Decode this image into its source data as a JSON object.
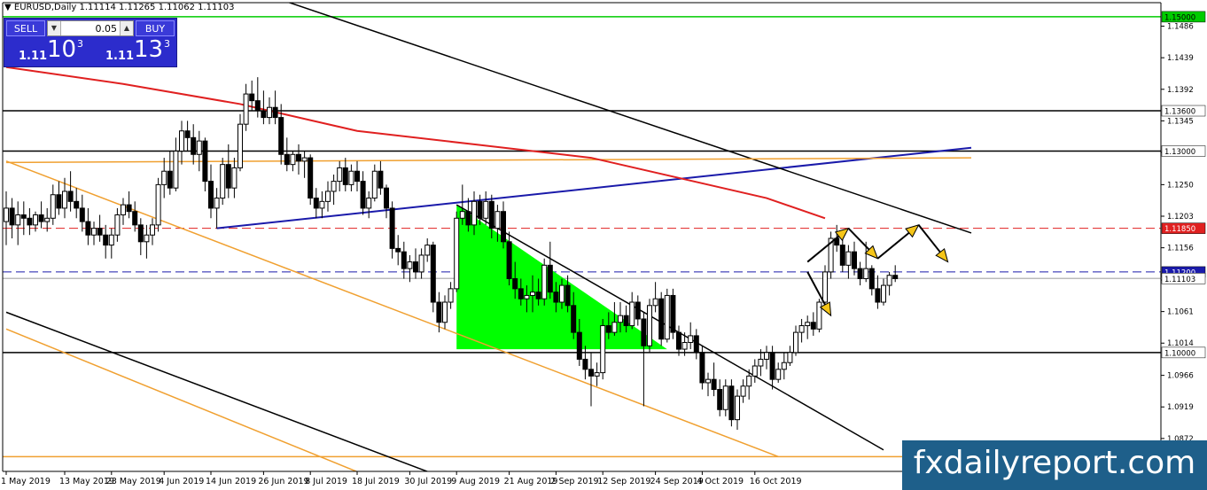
{
  "header": {
    "icon": "triangle-down-icon",
    "symbol": "EURUSD,Daily",
    "ohlc": "1.11114 1.11265 1.11062 1.11103"
  },
  "trade_panel": {
    "sell_label": "SELL",
    "buy_label": "BUY",
    "lot_value": "0.05",
    "sell_price_prefix": "1.11",
    "sell_price_big": "10",
    "sell_price_sup": "3",
    "buy_price_prefix": "1.11",
    "buy_price_big": "13",
    "buy_price_sup": "3"
  },
  "watermark": "fxdailyreport.com",
  "colors": {
    "bull": "#ffffff",
    "bear": "#000000",
    "ma": "#e02020",
    "trend_blue": "#1a1aaa",
    "channel_orange": "#f0a030",
    "level_green": "#00cc00",
    "triangle_fill": "#00ff00",
    "arrow_fill": "#f5c518"
  },
  "chart_data": {
    "type": "candlestick",
    "symbol": "EURUSD",
    "timeframe": "Daily",
    "ylim": [
      1.0823,
      1.1521
    ],
    "y_ticks": [
      1.1486,
      1.1439,
      1.1392,
      1.1345,
      1.1298,
      1.125,
      1.1203,
      1.1156,
      1.1108,
      1.1061,
      1.1014,
      1.0966,
      1.0919,
      1.0872
    ],
    "x_ticks": [
      "1 May 2019",
      "13 May 2019",
      "23 May 2019",
      "4 Jun 2019",
      "14 Jun 2019",
      "26 Jun 2019",
      "8 Jul 2019",
      "18 Jul 2019",
      "30 Jul 2019",
      "9 Aug 2019",
      "21 Aug 2019",
      "2 Sep 2019",
      "12 Sep 2019",
      "24 Sep 2019",
      "4 Oct 2019",
      "16 Oct 2019"
    ],
    "x_tick_bars": [
      0,
      10,
      18,
      27,
      35,
      44,
      52,
      60,
      69,
      77,
      86,
      94,
      102,
      111,
      119,
      128
    ],
    "hlines": [
      {
        "price": 1.15,
        "label": "1.15000",
        "color": "#00cc00",
        "style": "solid",
        "label_bg": "#00cc00",
        "label_fg": "#000000"
      },
      {
        "price": 1.136,
        "label": "1.13600",
        "color": "#000000",
        "style": "solid",
        "label_bg": "#ffffff",
        "label_fg": "#000000"
      },
      {
        "price": 1.13,
        "label": "1.13000",
        "color": "#000000",
        "style": "solid",
        "label_bg": "#ffffff",
        "label_fg": "#000000"
      },
      {
        "price": 1.1185,
        "label": "1.11850",
        "color": "#e02020",
        "style": "dashed",
        "label_bg": "#e02020",
        "label_fg": "#ffffff"
      },
      {
        "price": 1.112,
        "label": "1.11200",
        "color": "#1a1aaa",
        "style": "dashed",
        "label_bg": "#1a1aaa",
        "label_fg": "#ffffff"
      },
      {
        "price": 1.11103,
        "label": "1.11103",
        "color": "#bbbbbb",
        "style": "solid",
        "label_bg": "#ffffff",
        "label_fg": "#000000"
      },
      {
        "price": 1.1,
        "label": "1.10000",
        "color": "#000000",
        "style": "solid",
        "label_bg": "#ffffff",
        "label_fg": "#000000"
      },
      {
        "price": 1.0845,
        "label": "",
        "color": "#f0a030",
        "style": "solid",
        "label_bg": "#ffffff",
        "label_fg": "#000000"
      }
    ],
    "candles": [
      [
        1.1195,
        1.124,
        1.116,
        1.1215
      ],
      [
        1.1215,
        1.123,
        1.117,
        1.119
      ],
      [
        1.119,
        1.1225,
        1.116,
        1.1205
      ],
      [
        1.1205,
        1.1225,
        1.1175,
        1.12
      ],
      [
        1.12,
        1.1215,
        1.1175,
        1.119
      ],
      [
        1.119,
        1.121,
        1.118,
        1.1205
      ],
      [
        1.1205,
        1.1225,
        1.1185,
        1.1195
      ],
      [
        1.1195,
        1.1215,
        1.118,
        1.12
      ],
      [
        1.12,
        1.125,
        1.119,
        1.1235
      ],
      [
        1.1235,
        1.1255,
        1.1205,
        1.1215
      ],
      [
        1.1215,
        1.126,
        1.12,
        1.124
      ],
      [
        1.124,
        1.127,
        1.121,
        1.1225
      ],
      [
        1.1225,
        1.1245,
        1.12,
        1.1215
      ],
      [
        1.1215,
        1.1235,
        1.118,
        1.1195
      ],
      [
        1.1195,
        1.1215,
        1.116,
        1.1175
      ],
      [
        1.1175,
        1.1195,
        1.116,
        1.1185
      ],
      [
        1.1185,
        1.1205,
        1.1165,
        1.1175
      ],
      [
        1.1175,
        1.119,
        1.114,
        1.116
      ],
      [
        1.116,
        1.1185,
        1.114,
        1.1175
      ],
      [
        1.1175,
        1.1215,
        1.1165,
        1.1205
      ],
      [
        1.1205,
        1.123,
        1.119,
        1.122
      ],
      [
        1.122,
        1.124,
        1.12,
        1.121
      ],
      [
        1.121,
        1.1225,
        1.118,
        1.119
      ],
      [
        1.119,
        1.12,
        1.1145,
        1.1165
      ],
      [
        1.1165,
        1.119,
        1.114,
        1.1175
      ],
      [
        1.1175,
        1.12,
        1.116,
        1.119
      ],
      [
        1.119,
        1.126,
        1.118,
        1.125
      ],
      [
        1.125,
        1.129,
        1.123,
        1.127
      ],
      [
        1.127,
        1.13,
        1.1235,
        1.1245
      ],
      [
        1.1245,
        1.132,
        1.124,
        1.13
      ],
      [
        1.13,
        1.1345,
        1.128,
        1.133
      ],
      [
        1.133,
        1.1345,
        1.13,
        1.132
      ],
      [
        1.132,
        1.134,
        1.128,
        1.1295
      ],
      [
        1.1295,
        1.133,
        1.127,
        1.1315
      ],
      [
        1.1315,
        1.132,
        1.124,
        1.1255
      ],
      [
        1.1255,
        1.128,
        1.12,
        1.1215
      ],
      [
        1.1215,
        1.1245,
        1.1185,
        1.123
      ],
      [
        1.123,
        1.129,
        1.122,
        1.128
      ],
      [
        1.128,
        1.131,
        1.123,
        1.1245
      ],
      [
        1.1245,
        1.129,
        1.123,
        1.1275
      ],
      [
        1.1275,
        1.1355,
        1.127,
        1.134
      ],
      [
        1.134,
        1.14,
        1.133,
        1.1385
      ],
      [
        1.1385,
        1.1405,
        1.136,
        1.1375
      ],
      [
        1.1375,
        1.141,
        1.135,
        1.136
      ],
      [
        1.136,
        1.139,
        1.134,
        1.135
      ],
      [
        1.135,
        1.138,
        1.134,
        1.1365
      ],
      [
        1.1365,
        1.139,
        1.134,
        1.135
      ],
      [
        1.135,
        1.137,
        1.128,
        1.1295
      ],
      [
        1.1295,
        1.132,
        1.127,
        1.128
      ],
      [
        1.128,
        1.13,
        1.127,
        1.1295
      ],
      [
        1.1295,
        1.131,
        1.1265,
        1.1285
      ],
      [
        1.1285,
        1.13,
        1.126,
        1.129
      ],
      [
        1.129,
        1.1295,
        1.122,
        1.123
      ],
      [
        1.123,
        1.1245,
        1.12,
        1.1215
      ],
      [
        1.1215,
        1.124,
        1.12,
        1.1225
      ],
      [
        1.1225,
        1.1255,
        1.121,
        1.124
      ],
      [
        1.124,
        1.1265,
        1.122,
        1.1255
      ],
      [
        1.1255,
        1.1285,
        1.124,
        1.1275
      ],
      [
        1.1275,
        1.129,
        1.124,
        1.125
      ],
      [
        1.125,
        1.128,
        1.124,
        1.127
      ],
      [
        1.127,
        1.1285,
        1.124,
        1.1255
      ],
      [
        1.1255,
        1.127,
        1.1205,
        1.1215
      ],
      [
        1.1215,
        1.124,
        1.12,
        1.123
      ],
      [
        1.123,
        1.128,
        1.1225,
        1.127
      ],
      [
        1.127,
        1.1285,
        1.1235,
        1.1245
      ],
      [
        1.1245,
        1.125,
        1.12,
        1.1215
      ],
      [
        1.1215,
        1.1225,
        1.114,
        1.1155
      ],
      [
        1.1155,
        1.1175,
        1.113,
        1.115
      ],
      [
        1.115,
        1.1165,
        1.111,
        1.1125
      ],
      [
        1.1125,
        1.1145,
        1.1105,
        1.1135
      ],
      [
        1.1135,
        1.1155,
        1.111,
        1.112
      ],
      [
        1.112,
        1.1155,
        1.111,
        1.1145
      ],
      [
        1.1145,
        1.117,
        1.1135,
        1.116
      ],
      [
        1.116,
        1.1165,
        1.106,
        1.1075
      ],
      [
        1.1075,
        1.109,
        1.103,
        1.1045
      ],
      [
        1.1045,
        1.1085,
        1.1035,
        1.1075
      ],
      [
        1.1075,
        1.1105,
        1.1065,
        1.1095
      ],
      [
        1.1095,
        1.121,
        1.109,
        1.12
      ],
      [
        1.12,
        1.125,
        1.119,
        1.121
      ],
      [
        1.121,
        1.123,
        1.118,
        1.119
      ],
      [
        1.119,
        1.124,
        1.1175,
        1.1225
      ],
      [
        1.1225,
        1.1235,
        1.119,
        1.12
      ],
      [
        1.12,
        1.124,
        1.119,
        1.1225
      ],
      [
        1.1225,
        1.1235,
        1.117,
        1.1185
      ],
      [
        1.1185,
        1.122,
        1.1165,
        1.121
      ],
      [
        1.121,
        1.1225,
        1.1155,
        1.1165
      ],
      [
        1.1165,
        1.118,
        1.11,
        1.111
      ],
      [
        1.111,
        1.1135,
        1.108,
        1.1095
      ],
      [
        1.1095,
        1.111,
        1.107,
        1.108
      ],
      [
        1.108,
        1.11,
        1.106,
        1.1085
      ],
      [
        1.1085,
        1.1115,
        1.106,
        1.109
      ],
      [
        1.109,
        1.111,
        1.107,
        1.108
      ],
      [
        1.108,
        1.114,
        1.107,
        1.113
      ],
      [
        1.113,
        1.1165,
        1.108,
        1.109
      ],
      [
        1.109,
        1.1105,
        1.106,
        1.1075
      ],
      [
        1.1075,
        1.111,
        1.1065,
        1.11
      ],
      [
        1.11,
        1.1115,
        1.106,
        1.107
      ],
      [
        1.107,
        1.109,
        1.102,
        1.103
      ],
      [
        1.103,
        1.105,
        1.098,
        1.099
      ],
      [
        1.099,
        1.101,
        1.096,
        1.0975
      ],
      [
        1.0975,
        1.1,
        1.092,
        1.0965
      ],
      [
        1.0965,
        1.0985,
        1.095,
        1.097
      ],
      [
        1.097,
        1.105,
        1.096,
        1.104
      ],
      [
        1.104,
        1.106,
        1.102,
        1.103
      ],
      [
        1.103,
        1.1075,
        1.1025,
        1.1045
      ],
      [
        1.1045,
        1.1075,
        1.103,
        1.1055
      ],
      [
        1.1055,
        1.107,
        1.103,
        1.104
      ],
      [
        1.104,
        1.109,
        1.1035,
        1.1075
      ],
      [
        1.1075,
        1.1085,
        1.104,
        1.105
      ],
      [
        1.105,
        1.106,
        1.092,
        1.101
      ],
      [
        1.101,
        1.108,
        1.1,
        1.107
      ],
      [
        1.107,
        1.1105,
        1.106,
        1.108
      ],
      [
        1.108,
        1.109,
        1.101,
        1.102
      ],
      [
        1.102,
        1.1095,
        1.1015,
        1.1085
      ],
      [
        1.1085,
        1.1095,
        1.102,
        1.103
      ],
      [
        1.103,
        1.104,
        1.0995,
        1.1005
      ],
      [
        1.1005,
        1.103,
        1.0995,
        1.1015
      ],
      [
        1.1015,
        1.1045,
        1.1005,
        1.1025
      ],
      [
        1.1025,
        1.1035,
        1.099,
        1.1
      ],
      [
        1.1,
        1.101,
        1.0945,
        1.0955
      ],
      [
        1.0955,
        1.097,
        1.0935,
        1.096
      ],
      [
        1.096,
        1.0985,
        1.0935,
        1.0945
      ],
      [
        1.0945,
        1.096,
        1.0905,
        1.0915
      ],
      [
        1.0915,
        1.096,
        1.0905,
        1.095
      ],
      [
        1.095,
        1.096,
        1.089,
        1.09
      ],
      [
        1.09,
        1.0945,
        1.0885,
        1.0935
      ],
      [
        1.0935,
        1.096,
        1.0925,
        1.095
      ],
      [
        1.095,
        1.0975,
        1.093,
        1.0965
      ],
      [
        1.0965,
        1.099,
        1.0955,
        1.098
      ],
      [
        1.098,
        1.1005,
        1.0965,
        1.099
      ],
      [
        1.099,
        1.101,
        1.0975,
        1.1
      ],
      [
        1.1,
        1.101,
        1.0945,
        1.096
      ],
      [
        1.096,
        1.0985,
        1.0955,
        1.0975
      ],
      [
        1.0975,
        1.1,
        1.096,
        1.0985
      ],
      [
        1.0985,
        1.101,
        1.098,
        1.1
      ],
      [
        1.1,
        1.104,
        1.0995,
        1.103
      ],
      [
        1.103,
        1.105,
        1.1015,
        1.104
      ],
      [
        1.104,
        1.1055,
        1.102,
        1.1045
      ],
      [
        1.1045,
        1.106,
        1.1025,
        1.1035
      ],
      [
        1.1035,
        1.108,
        1.103,
        1.1075
      ],
      [
        1.1075,
        1.113,
        1.107,
        1.112
      ],
      [
        1.112,
        1.118,
        1.111,
        1.117
      ],
      [
        1.117,
        1.119,
        1.115,
        1.116
      ],
      [
        1.116,
        1.1175,
        1.112,
        1.113
      ],
      [
        1.113,
        1.116,
        1.111,
        1.115
      ],
      [
        1.115,
        1.1165,
        1.1115,
        1.1125
      ],
      [
        1.1125,
        1.1135,
        1.11,
        1.111
      ],
      [
        1.111,
        1.1165,
        1.1105,
        1.1125
      ],
      [
        1.1125,
        1.113,
        1.1085,
        1.1095
      ],
      [
        1.1095,
        1.1115,
        1.1065,
        1.1075
      ],
      [
        1.1075,
        1.111,
        1.107,
        1.11
      ],
      [
        1.11,
        1.112,
        1.1085,
        1.1115
      ],
      [
        1.1115,
        1.113,
        1.1105,
        1.111
      ]
    ],
    "ma_line": [
      [
        0,
        1.1425
      ],
      [
        20,
        1.14
      ],
      [
        40,
        1.137
      ],
      [
        60,
        1.133
      ],
      [
        80,
        1.131
      ],
      [
        100,
        1.129
      ],
      [
        115,
        1.126
      ],
      [
        130,
        1.123
      ],
      [
        140,
        1.12
      ]
    ],
    "trendlines": [
      {
        "name": "blue-support",
        "color": "#1a1aaa",
        "width": 2,
        "points": [
          [
            36,
            1.1185
          ],
          [
            165,
            1.1305
          ]
        ]
      },
      {
        "name": "black-upper",
        "color": "#000000",
        "width": 1.5,
        "points": [
          [
            42,
            1.154
          ],
          [
            165,
            1.1178
          ]
        ]
      },
      {
        "name": "black-lower",
        "color": "#000000",
        "width": 1.5,
        "points": [
          [
            0,
            1.106
          ],
          [
            85,
            1.078
          ]
        ]
      },
      {
        "name": "black-wedge",
        "color": "#000000",
        "width": 1.5,
        "points": [
          [
            77,
            1.122
          ],
          [
            150,
            1.0855
          ]
        ]
      },
      {
        "name": "orange-upper",
        "color": "#f0a030",
        "width": 1.5,
        "points": [
          [
            0,
            1.1285
          ],
          [
            132,
            1.0845
          ]
        ]
      },
      {
        "name": "orange-lower",
        "color": "#f0a030",
        "width": 1.5,
        "points": [
          [
            0,
            1.1035
          ],
          [
            72,
            1.078
          ]
        ]
      },
      {
        "name": "orange-horizontal",
        "color": "#f0a030",
        "width": 1.5,
        "points": [
          [
            0,
            1.1283
          ],
          [
            165,
            1.129
          ]
        ]
      }
    ],
    "triangle": [
      [
        77,
        1.122
      ],
      [
        77,
        1.1005
      ],
      [
        113,
        1.1005
      ]
    ],
    "projection_arrows": [
      {
        "from": [
          137,
          1.1135
        ],
        "to": [
          144,
          1.1185
        ]
      },
      {
        "from": [
          144,
          1.1185
        ],
        "to": [
          149,
          1.114
        ]
      },
      {
        "from": [
          149,
          1.114
        ],
        "to": [
          156,
          1.119
        ]
      },
      {
        "from": [
          156,
          1.119
        ],
        "to": [
          161,
          1.1135
        ]
      },
      {
        "from": [
          137,
          1.112
        ],
        "to": [
          141,
          1.1055
        ]
      }
    ]
  }
}
